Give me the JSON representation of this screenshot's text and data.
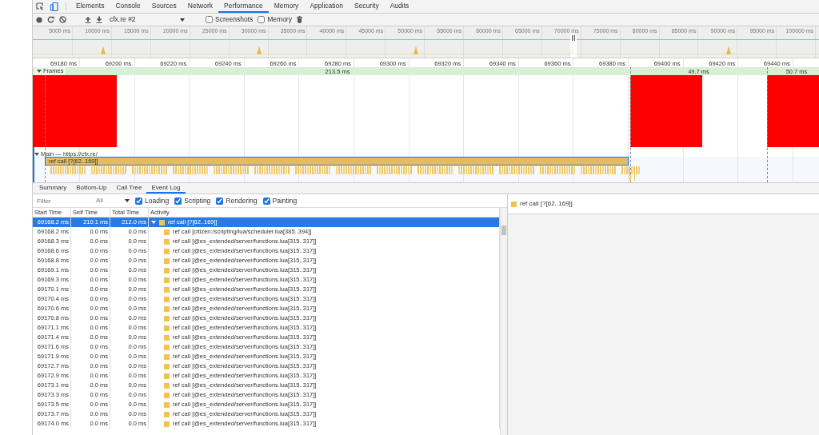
{
  "panel_tabs": [
    {
      "label": "Elements",
      "selected": false
    },
    {
      "label": "Console",
      "selected": false
    },
    {
      "label": "Sources",
      "selected": false
    },
    {
      "label": "Network",
      "selected": false
    },
    {
      "label": "Performance",
      "selected": true
    },
    {
      "label": "Memory",
      "selected": false
    },
    {
      "label": "Application",
      "selected": false
    },
    {
      "label": "Security",
      "selected": false
    },
    {
      "label": "Audits",
      "selected": false
    }
  ],
  "toolbar": {
    "profile_select": "cfx.re #2",
    "options": [
      {
        "label": "Screenshots",
        "checked": false
      },
      {
        "label": "Memory",
        "checked": false
      }
    ]
  },
  "overview": {
    "ticks": [
      "5000 ms",
      "10000 ms",
      "15000 ms",
      "20000 ms",
      "25000 ms",
      "30000 ms",
      "35000 ms",
      "40000 ms",
      "45000 ms",
      "50000 ms",
      "55000 ms",
      "60000 ms",
      "65000 ms",
      "70000 ms",
      "75000 ms",
      "80000 ms",
      "85000 ms",
      "90000 ms",
      "95000 ms",
      "100000 ms"
    ]
  },
  "ruler": {
    "ticks": [
      "69180 ms",
      "69200 ms",
      "69220 ms",
      "69240 ms",
      "69260 ms",
      "69280 ms",
      "69300 ms",
      "69320 ms",
      "69340 ms",
      "69360 ms",
      "69380 ms",
      "69400 ms",
      "69420 ms",
      "69440 ms"
    ]
  },
  "frames": {
    "label": "Frames",
    "expanded": true,
    "durations": [
      "213.5 ms",
      "49.7 ms",
      "50.7 ms"
    ]
  },
  "main": {
    "label": "Main — https://cfx.re/",
    "expanded": true,
    "event": "ref call [?[62..169]]"
  },
  "bottom_tabs": [
    {
      "label": "Summary",
      "selected": false
    },
    {
      "label": "Bottom-Up",
      "selected": false
    },
    {
      "label": "Call Tree",
      "selected": false
    },
    {
      "label": "Event Log",
      "selected": true
    }
  ],
  "filter": {
    "placeholder": "Filter",
    "duration": "All",
    "categories": [
      {
        "label": "Loading",
        "checked": true
      },
      {
        "label": "Scripting",
        "checked": true
      },
      {
        "label": "Rendering",
        "checked": true
      },
      {
        "label": "Painting",
        "checked": true
      }
    ]
  },
  "table": {
    "columns": [
      "Start Time",
      "Self Time",
      "Total Time",
      "Activity"
    ],
    "rows": [
      {
        "start": "69168.2 ms",
        "self": "210.1 ms",
        "total": "212.0 ms",
        "activity": "ref call [?[62..169]]",
        "selected": true,
        "expanded": true,
        "children": [
          {
            "start": "69168.2 ms",
            "self": "0.0 ms",
            "total": "0.0 ms",
            "activity": "ref call [citizen:/scripting/lua/scheduler.lua[385..394]]",
            "selected": false
          },
          {
            "start": "69168.3 ms",
            "self": "0.0 ms",
            "total": "0.0 ms",
            "activity": "ref call [@es_extended/server/functions.lua[315..317]]",
            "selected": false
          },
          {
            "start": "69168.6 ms",
            "self": "0.0 ms",
            "total": "0.0 ms",
            "activity": "ref call [@es_extended/server/functions.lua[315..317]]",
            "selected": false
          },
          {
            "start": "69168.8 ms",
            "self": "0.0 ms",
            "total": "0.0 ms",
            "activity": "ref call [@es_extended/server/functions.lua[315..317]]",
            "selected": false
          },
          {
            "start": "69169.1 ms",
            "self": "0.0 ms",
            "total": "0.0 ms",
            "activity": "ref call [@es_extended/server/functions.lua[315..317]]",
            "selected": false
          },
          {
            "start": "69169.3 ms",
            "self": "0.0 ms",
            "total": "0.0 ms",
            "activity": "ref call [@es_extended/server/functions.lua[315..317]]",
            "selected": false
          },
          {
            "start": "69170.1 ms",
            "self": "0.0 ms",
            "total": "0.0 ms",
            "activity": "ref call [@es_extended/server/functions.lua[315..317]]",
            "selected": false
          },
          {
            "start": "69170.4 ms",
            "self": "0.0 ms",
            "total": "0.0 ms",
            "activity": "ref call [@es_extended/server/functions.lua[315..317]]",
            "selected": false
          },
          {
            "start": "69170.6 ms",
            "self": "0.0 ms",
            "total": "0.0 ms",
            "activity": "ref call [@es_extended/server/functions.lua[315..317]]",
            "selected": false
          },
          {
            "start": "69170.8 ms",
            "self": "0.0 ms",
            "total": "0.0 ms",
            "activity": "ref call [@es_extended/server/functions.lua[315..317]]",
            "selected": false
          },
          {
            "start": "69171.1 ms",
            "self": "0.0 ms",
            "total": "0.0 ms",
            "activity": "ref call [@es_extended/server/functions.lua[315..317]]",
            "selected": false
          },
          {
            "start": "69171.4 ms",
            "self": "0.0 ms",
            "total": "0.0 ms",
            "activity": "ref call [@es_extended/server/functions.lua[315..317]]",
            "selected": false
          },
          {
            "start": "69171.6 ms",
            "self": "0.0 ms",
            "total": "0.0 ms",
            "activity": "ref call [@es_extended/server/functions.lua[315..317]]",
            "selected": false
          },
          {
            "start": "69171.9 ms",
            "self": "0.0 ms",
            "total": "0.0 ms",
            "activity": "ref call [@es_extended/server/functions.lua[315..317]]",
            "selected": false
          },
          {
            "start": "69172.7 ms",
            "self": "0.0 ms",
            "total": "0.0 ms",
            "activity": "ref call [@es_extended/server/functions.lua[315..317]]",
            "selected": false
          },
          {
            "start": "69172.9 ms",
            "self": "0.0 ms",
            "total": "0.0 ms",
            "activity": "ref call [@es_extended/server/functions.lua[315..317]]",
            "selected": false
          },
          {
            "start": "69173.1 ms",
            "self": "0.0 ms",
            "total": "0.0 ms",
            "activity": "ref call [@es_extended/server/functions.lua[315..317]]",
            "selected": false
          },
          {
            "start": "69173.3 ms",
            "self": "0.0 ms",
            "total": "0.0 ms",
            "activity": "ref call [@es_extended/server/functions.lua[315..317]]",
            "selected": false
          },
          {
            "start": "69173.5 ms",
            "self": "0.0 ms",
            "total": "0.0 ms",
            "activity": "ref call [@es_extended/server/functions.lua[315..317]]",
            "selected": false
          },
          {
            "start": "69173.7 ms",
            "self": "0.0 ms",
            "total": "0.0 ms",
            "activity": "ref call [@es_extended/server/functions.lua[315..317]]",
            "selected": false
          },
          {
            "start": "69174.0 ms",
            "self": "0.0 ms",
            "total": "0.0 ms",
            "activity": "ref call [@es_extended/server/functions.lua[315..317]]",
            "selected": false
          }
        ]
      }
    ]
  },
  "details": {
    "title": "ref call [?[62..169]]"
  }
}
